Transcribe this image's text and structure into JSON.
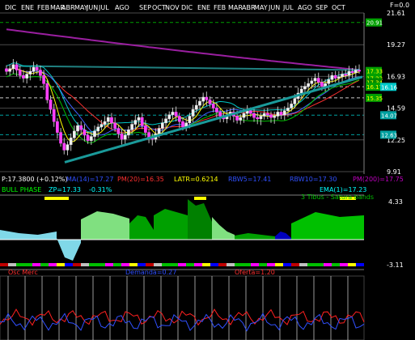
{
  "top_axis": {
    "month_labels": [
      "DIC",
      "ENE",
      "FEB",
      "MAR",
      "ABR",
      "MAY",
      "JUN",
      "JUL",
      "AGO",
      "SEP",
      "OCT",
      "NOV",
      "DIC",
      "ENE",
      "FEB",
      "MAR",
      "ABR",
      "MAY",
      "JUN",
      "JUL",
      "AGO",
      "SEP",
      "OCT"
    ],
    "corner_label": "F=0.0"
  },
  "price_axis": {
    "ticks": [
      "21.61",
      "19.27",
      "16.93",
      "14.59",
      "12.25",
      "9.91"
    ]
  },
  "price_tags": [
    {
      "text": "20.91",
      "bg": "#00a000",
      "fg": "#ffffff"
    },
    {
      "text": "17.33",
      "bg": "#00a000",
      "fg": "#ffff00"
    },
    {
      "text": "17.23",
      "bg": "#00a000",
      "fg": "#ffff00"
    },
    {
      "text": "17.34",
      "bg": "#008800",
      "fg": "#ffff00"
    },
    {
      "text": "16.17",
      "bg": "#00a000",
      "fg": "#ffff00"
    },
    {
      "text": "16.16",
      "bg": "#00c8c8",
      "fg": "#ffffff"
    },
    {
      "text": "15.35",
      "bg": "#00a000",
      "fg": "#ffff00"
    },
    {
      "text": "14.07",
      "bg": "#00a0a0",
      "fg": "#ffffff"
    },
    {
      "text": "12.63",
      "bg": "#00a0a0",
      "fg": "#ffffff"
    }
  ],
  "indicator_text": {
    "row1": [
      {
        "text": "P:17.3800 (+0.12%)",
        "color": "#ffffff"
      },
      {
        "text": "MA(14)=17.27",
        "color": "#3050ff"
      },
      {
        "text": "PM(20)=16.35",
        "color": "#ff3030"
      },
      {
        "text": "LATR=0.6214",
        "color": "#ffff00"
      },
      {
        "text": "RBW5=17.41",
        "color": "#3050ff"
      },
      {
        "text": "RBW10=17.30",
        "color": "#3050ff"
      },
      {
        "text": "PM(200)=17.75",
        "color": "#c000c0"
      }
    ],
    "row2": [
      {
        "text": "BULL PHASE",
        "color": "#00ff00"
      },
      {
        "text": "ZP=17.33",
        "color": "#00ffff"
      },
      {
        "text": "-0.31%",
        "color": "#00ffff"
      },
      {
        "text": "EMA(1)=17.23",
        "color": "#00ffff"
      }
    ]
  },
  "oscillator": {
    "title": "3 Tibus - Satura bands",
    "top_value": "4.33",
    "bottom_value": "-3.11"
  },
  "bottom_panel": {
    "labels": [
      {
        "text": "Osc Merc",
        "color": "#ff3030"
      },
      {
        "text": "Demanda=0.27",
        "color": "#3050ff"
      },
      {
        "text": "Oferta=1.20",
        "color": "#ff3030"
      }
    ]
  },
  "chart_data": [
    {
      "type": "candlestick",
      "title": "",
      "ylim": [
        9.91,
        21.61
      ],
      "candles_close_approx": [
        17.3,
        17.5,
        17.8,
        17.4,
        17.0,
        16.8,
        17.1,
        17.3,
        17.6,
        17.4,
        17.0,
        16.4,
        15.2,
        14.5,
        13.6,
        12.8,
        12.0,
        11.5,
        11.9,
        12.4,
        12.9,
        13.3,
        13.0,
        12.6,
        12.2,
        12.5,
        12.9,
        13.2,
        13.4,
        13.6,
        13.9,
        13.5,
        13.1,
        12.7,
        12.3,
        12.6,
        13.0,
        13.4,
        13.7,
        13.9,
        13.3,
        12.8,
        12.4,
        12.3,
        12.7,
        13.1,
        13.5,
        13.8,
        14.1,
        14.3,
        14.0,
        13.6,
        13.2,
        13.5,
        14.0,
        14.5,
        14.8,
        15.1,
        15.4,
        15.2,
        14.9,
        14.6,
        14.3,
        14.0,
        13.8,
        14.1,
        14.3,
        14.0,
        13.7,
        13.9,
        14.2,
        14.4,
        14.2,
        13.9,
        13.8,
        14.0,
        14.2,
        14.1,
        13.9,
        14.0,
        14.3,
        14.1,
        14.4,
        14.6,
        14.9,
        15.3,
        15.7,
        16.0,
        16.2,
        16.4,
        16.6,
        16.8,
        16.5,
        16.2,
        16.4,
        16.7,
        17.0,
        16.8,
        16.9,
        17.1,
        17.0,
        17.3,
        17.2,
        17.4,
        17.38
      ]
    },
    {
      "type": "area",
      "name": "oscillator",
      "ylim": [
        -3.11,
        4.33
      ]
    },
    {
      "type": "line",
      "series": [
        {
          "name": "Demanda",
          "color": "#3050ff"
        },
        {
          "name": "Oferta",
          "color": "#ff3030"
        }
      ]
    }
  ]
}
